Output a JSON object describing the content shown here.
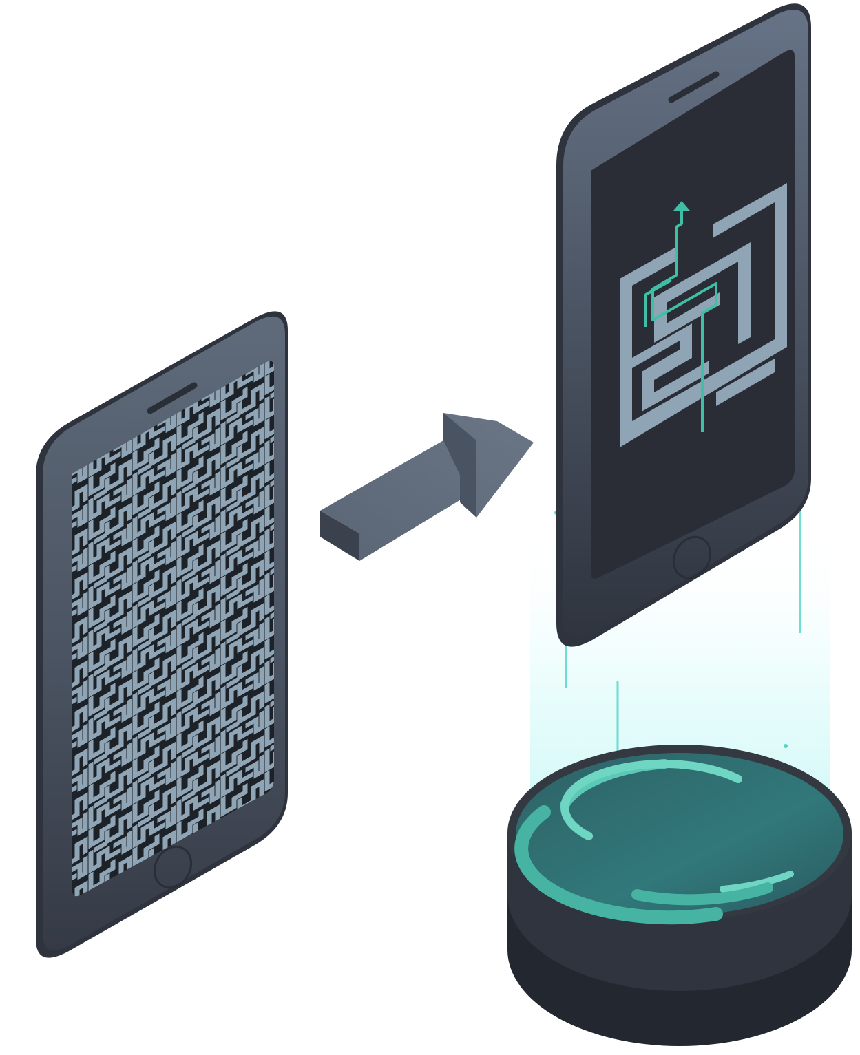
{
  "illustration": {
    "left_phone": {
      "screen_content": "complex-maze"
    },
    "arrow": {
      "direction": "up-right"
    },
    "right_phone": {
      "screen_content": "simple-maze-with-solution-path"
    },
    "projector": {
      "ring_count": 3
    }
  },
  "colors": {
    "background": "#ffffff",
    "phone_body_light": "#5f6b7b",
    "phone_body_dark": "#2e333d",
    "screen": "#2a2d35",
    "maze_wall": "#8fa5b5",
    "solution_path": "#3fbfa5",
    "beam": "#d6fbfa",
    "ring_bright": "#6fd6c4",
    "ring_mid": "#46b3a3",
    "base_top": "#2f6f73",
    "base_side": "#23272f"
  }
}
